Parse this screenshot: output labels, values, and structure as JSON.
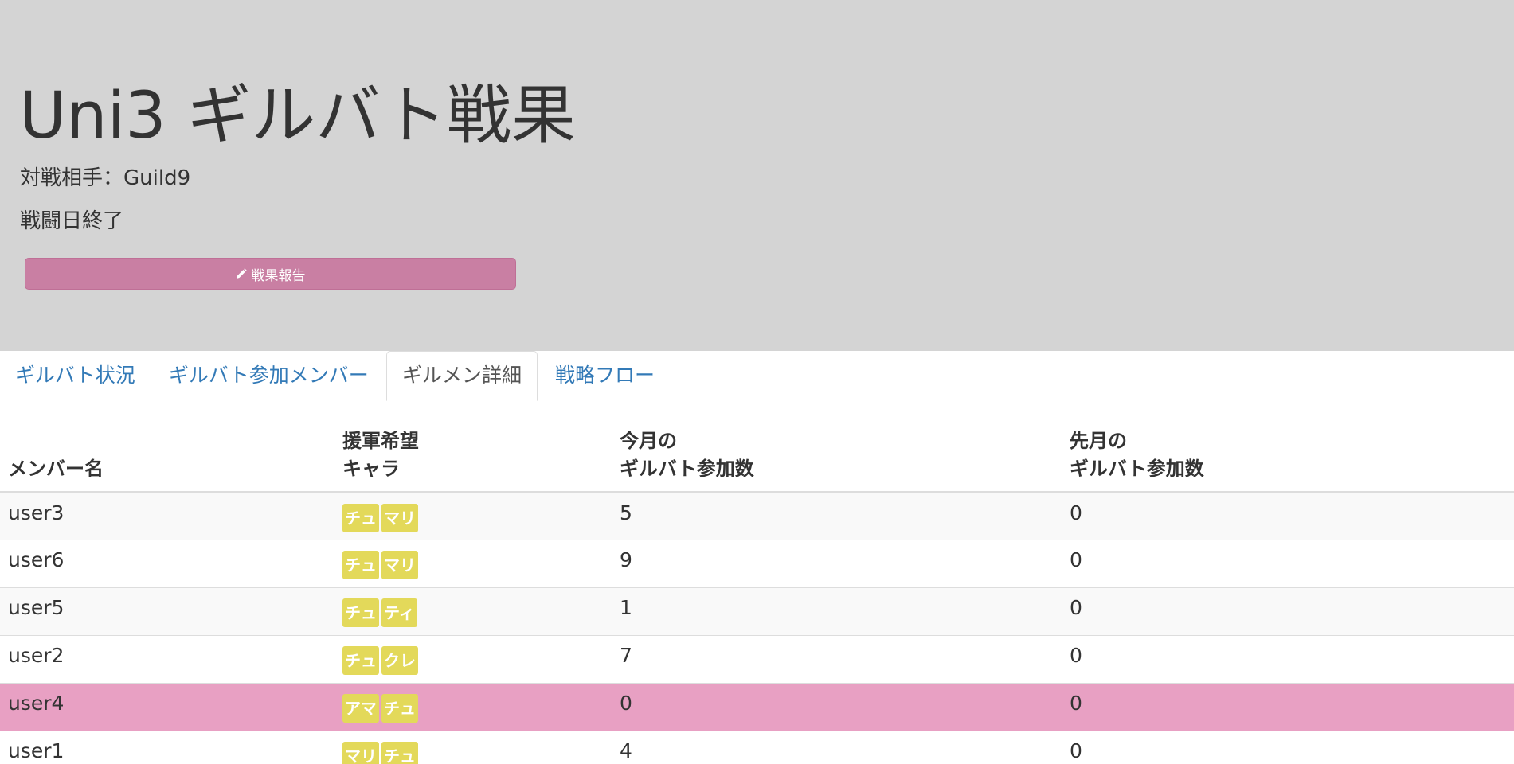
{
  "header": {
    "title": "Uni3 ギルバト戦果",
    "opponent": "対戦相手：Guild9",
    "status": "戦闘日終了",
    "report_button_label": "戦果報告",
    "report_button_icon": "pencil-icon"
  },
  "tabs": [
    {
      "label": "ギルバト状況",
      "active": false
    },
    {
      "label": "ギルバト参加メンバー",
      "active": false
    },
    {
      "label": "ギルメン詳細",
      "active": true
    },
    {
      "label": "戦略フロー",
      "active": false
    }
  ],
  "table": {
    "headers": {
      "member": "メンバー名",
      "support_line1": "援軍希望",
      "support_line2": "キャラ",
      "this_month_line1": "今月の",
      "this_month_line2": "ギルバト参加数",
      "last_month_line1": "先月の",
      "last_month_line2": "ギルバト参加数"
    },
    "rows": [
      {
        "name": "user3",
        "chars": [
          "チュ",
          "マリ"
        ],
        "this_month": "5",
        "last_month": "0"
      },
      {
        "name": "user6",
        "chars": [
          "チュ",
          "マリ"
        ],
        "this_month": "9",
        "last_month": "0"
      },
      {
        "name": "user5",
        "chars": [
          "チュ",
          "ティ"
        ],
        "this_month": "1",
        "last_month": "0"
      },
      {
        "name": "user2",
        "chars": [
          "チュ",
          "クレ"
        ],
        "this_month": "7",
        "last_month": "0"
      },
      {
        "name": "user4",
        "chars": [
          "アマ",
          "チュ"
        ],
        "this_month": "0",
        "last_month": "0",
        "highlight": true
      },
      {
        "name": "user1",
        "chars": [
          "マリ",
          "チュ"
        ],
        "this_month": "4",
        "last_month": "0"
      }
    ]
  },
  "colors": {
    "header_bg": "#d4d4d4",
    "report_button": "#c97fa3",
    "badge": "#e3d95a",
    "highlight_row": "#e8a0c3",
    "link": "#337ab7"
  }
}
